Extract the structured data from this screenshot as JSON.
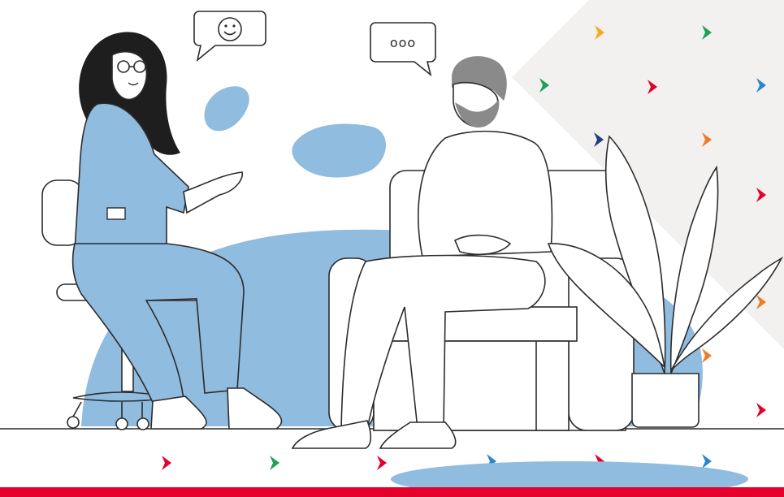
{
  "colors": {
    "accent_red": "#e4002b",
    "figure_blue": "#8fbcdf",
    "outline": "#2c2c2c",
    "panel_grey": "#f2f1ef",
    "hair_dark": "#1e1e1e",
    "beard_grey": "#8a8a8a",
    "arrow_palette": [
      "#f7a823",
      "#1fa05a",
      "#e4002b",
      "#2a86cc",
      "#1d3f7a",
      "#ef7b2a"
    ]
  },
  "icons": {
    "smiley_bubble": "smiley-face-icon",
    "typing_bubble": "ellipsis-icon",
    "decor_arrow": "chevron-right-icon"
  },
  "typing_dots": "ooo"
}
